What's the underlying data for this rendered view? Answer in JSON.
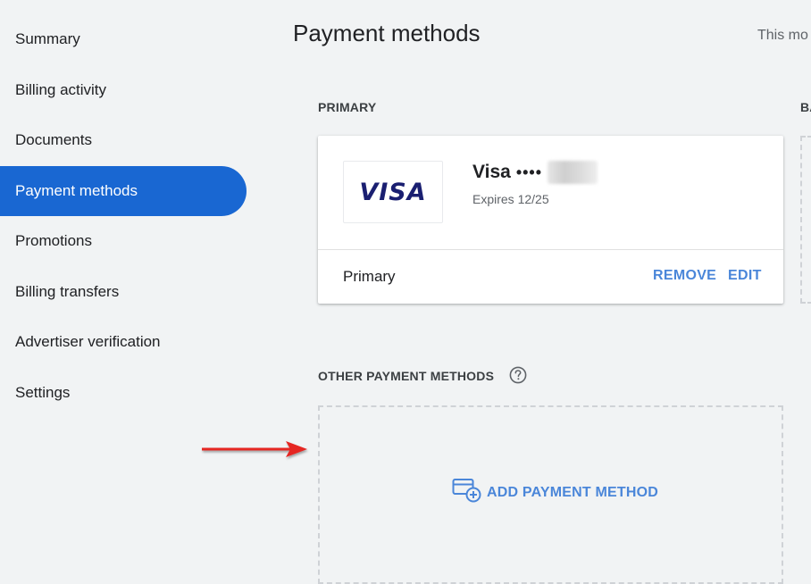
{
  "sidebar": {
    "items": [
      {
        "label": "Summary"
      },
      {
        "label": "Billing activity"
      },
      {
        "label": "Documents"
      },
      {
        "label": "Payment methods",
        "active": true
      },
      {
        "label": "Promotions"
      },
      {
        "label": "Billing transfers"
      },
      {
        "label": "Advertiser verification"
      },
      {
        "label": "Settings"
      }
    ]
  },
  "header": {
    "title": "Payment methods",
    "period_label": "This mo"
  },
  "primary_section": {
    "label": "PRIMARY",
    "side_label": "BA",
    "card": {
      "logo_text": "VISA",
      "name": "Visa",
      "masked_digits": "••••",
      "expiry": "Expires 12/25",
      "status": "Primary",
      "remove_label": "REMOVE",
      "edit_label": "EDIT"
    }
  },
  "other_section": {
    "label": "OTHER PAYMENT METHODS",
    "help_icon": "help-circle-icon",
    "add_label": "ADD PAYMENT METHOD",
    "add_icon": "add-card-icon"
  },
  "colors": {
    "accent": "#1967d2",
    "link": "#4a86d9",
    "background": "#f1f3f4",
    "visa": "#1a1f71",
    "annotation_arrow": "#e52521"
  }
}
